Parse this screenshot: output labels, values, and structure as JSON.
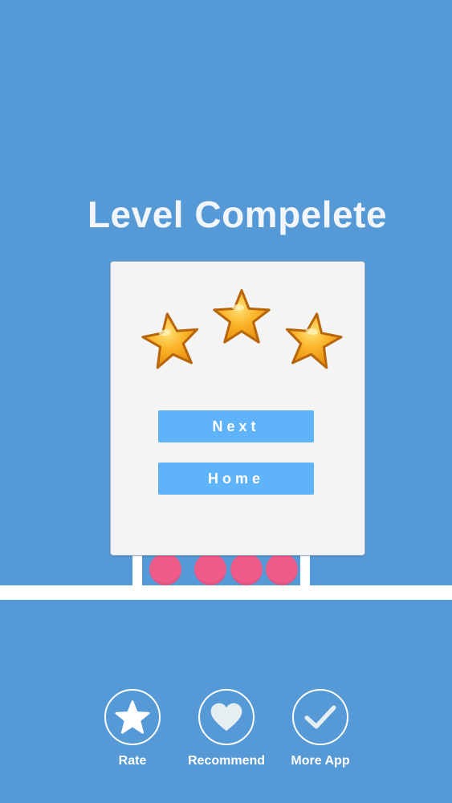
{
  "level_complete": {
    "title": "Level Compelete",
    "stars_earned": 3,
    "stars_total": 3,
    "next_label": "Next",
    "home_label": "Home"
  },
  "bottom_bar": {
    "rate_label": "Rate",
    "recommend_label": "Recommend",
    "more_app_label": "More App"
  },
  "icons": {
    "star": "star-icon",
    "heart": "heart-icon",
    "check": "checkmark-icon"
  },
  "colors": {
    "background": "#559ad7",
    "button": "#5eb3f9",
    "ball": "#ef5c8a",
    "star_gold": "#f5a623"
  }
}
